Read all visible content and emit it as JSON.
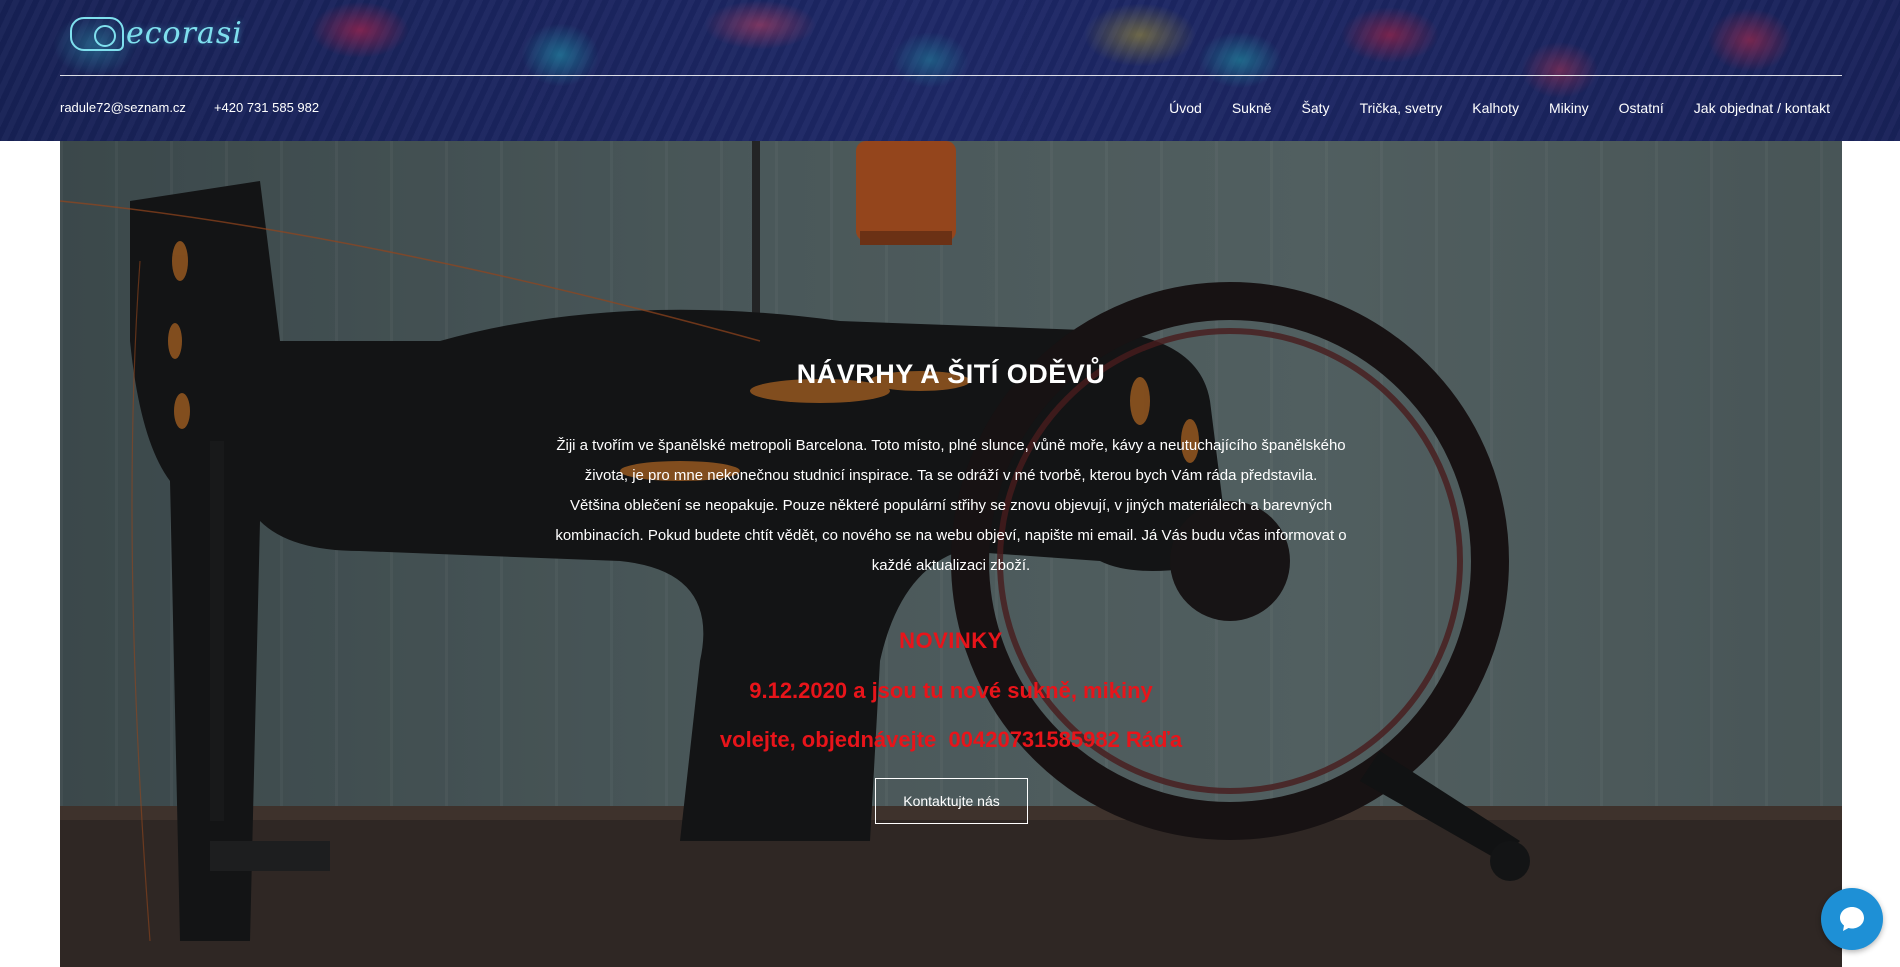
{
  "header": {
    "logo_text": "ecorasi",
    "contact": {
      "email": "radule72@seznam.cz",
      "phone": "+420 731 585 982"
    },
    "nav": [
      {
        "label": "Úvod"
      },
      {
        "label": "Sukně"
      },
      {
        "label": "Šaty"
      },
      {
        "label": "Trička, svetry"
      },
      {
        "label": "Kalhoty"
      },
      {
        "label": "Mikiny"
      },
      {
        "label": "Ostatní"
      },
      {
        "label": "Jak objednat / kontakt"
      }
    ]
  },
  "hero": {
    "title": "NÁVRHY A ŠITÍ ODĚVŮ",
    "paragraph1": "Žiji a tvořím ve španělské metropoli Barcelona. Toto místo, plné slunce, vůně moře, kávy a neutuchajícího španělského života, je pro mne nekonečnou studnicí inspirace. Ta se odráží v mé tvorbě, kterou bych Vám ráda představila.",
    "paragraph2": "Většina oblečení se neopakuje. Pouze některé populární střihy se znovu objevují, v jiných materiálech a barevných kombinacích. Pokud budete chtít vědět, co nového se na webu objeví, napište mi email. Já Vás budu včas informovat o každé aktualizaci zboží.",
    "news_title": "NOVINKY",
    "news_line1": "9.12.2020 a jsou tu nové sukně, mikiny",
    "news_line2": "volejte, objednávejte  00420731585982 Ráďa",
    "cta_label": "Kontaktujte nás"
  },
  "chat": {
    "icon": "chat-bubble-icon"
  },
  "colors": {
    "header_bg": "#23307a",
    "news_red": "#e8141a",
    "chat_blue": "#1e90d6",
    "logo_cyan": "#7fe0ee"
  }
}
